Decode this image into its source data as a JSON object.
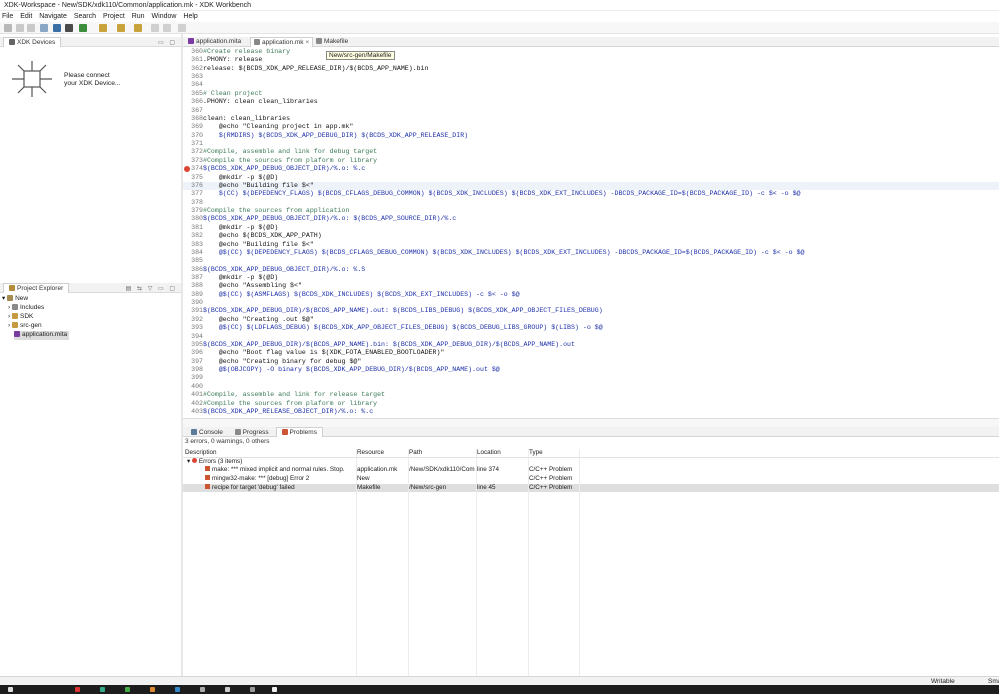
{
  "window": {
    "title": "XDK-Workspace - New/SDK/xdk110/Common/application.mk - XDK Workbench"
  },
  "menu": [
    "File",
    "Edit",
    "Navigate",
    "Search",
    "Project",
    "Run",
    "Window",
    "Help"
  ],
  "devices": {
    "tab": "XDK Devices",
    "message_line1": "Please connect",
    "message_line2": "your XDK Device..."
  },
  "explorer": {
    "tab": "Project Explorer",
    "items": [
      {
        "label": "New"
      },
      {
        "label": "Includes"
      },
      {
        "label": "SDK"
      },
      {
        "label": "src-gen"
      },
      {
        "label": "application.mita"
      }
    ]
  },
  "editor": {
    "tabs": [
      {
        "label": "application.mita"
      },
      {
        "label": "application.mk"
      },
      {
        "label": "Makefile"
      }
    ],
    "tooltip": "New/src-gen/Makefile",
    "lines": [
      {
        "n": "360",
        "t": "#Create release binary"
      },
      {
        "n": "361",
        "t": ".PHONY: release"
      },
      {
        "n": "362",
        "t": "release: $(BCDS_XDK_APP_RELEASE_DIR)/$(BCDS_APP_NAME).bin"
      },
      {
        "n": "363",
        "t": ""
      },
      {
        "n": "364",
        "t": ""
      },
      {
        "n": "365",
        "t": "# Clean project"
      },
      {
        "n": "366",
        "t": ".PHONY: clean clean_libraries"
      },
      {
        "n": "367",
        "t": ""
      },
      {
        "n": "368",
        "t": "clean: clean_libraries"
      },
      {
        "n": "369",
        "t": "    @echo \"Cleaning project in app.mk\""
      },
      {
        "n": "370",
        "t": "    $(RMDIRS) $(BCDS_XDK_APP_DEBUG_DIR) $(BCDS_XDK_APP_RELEASE_DIR)"
      },
      {
        "n": "371",
        "t": ""
      },
      {
        "n": "372",
        "t": "#Compile, assemble and link for debug target"
      },
      {
        "n": "373",
        "t": "#Compile the sources from plaform or library"
      },
      {
        "n": "374",
        "t": "$(BCDS_XDK_APP_DEBUG_OBJECT_DIR)/%.o: %.c"
      },
      {
        "n": "375",
        "t": "    @mkdir -p $(@D)"
      },
      {
        "n": "376",
        "t": "    @echo \"Building file $<\""
      },
      {
        "n": "377",
        "t": "    $(CC) $(DEPEDENCY_FLAGS) $(BCDS_CFLAGS_DEBUG_COMMON) $(BCDS_XDK_INCLUDES) $(BCDS_XDK_EXT_INCLUDES) -DBCDS_PACKAGE_ID=$(BCDS_PACKAGE_ID) -c $< -o $@"
      },
      {
        "n": "378",
        "t": ""
      },
      {
        "n": "379",
        "t": "#Compile the sources from application"
      },
      {
        "n": "380",
        "t": "$(BCDS_XDK_APP_DEBUG_OBJECT_DIR)/%.o: $(BCDS_APP_SOURCE_DIR)/%.c"
      },
      {
        "n": "381",
        "t": "    @mkdir -p $(@D)"
      },
      {
        "n": "382",
        "t": "    @echo $(BCDS_XDK_APP_PATH)"
      },
      {
        "n": "383",
        "t": "    @echo \"Building file $<\""
      },
      {
        "n": "384",
        "t": "    @$(CC) $(DEPEDENCY_FLAGS) $(BCDS_CFLAGS_DEBUG_COMMON) $(BCDS_XDK_INCLUDES) $(BCDS_XDK_EXT_INCLUDES) -DBCDS_PACKAGE_ID=$(BCDS_PACKAGE_ID) -c $< -o $@"
      },
      {
        "n": "385",
        "t": ""
      },
      {
        "n": "386",
        "t": "$(BCDS_XDK_APP_DEBUG_OBJECT_DIR)/%.o: %.S"
      },
      {
        "n": "387",
        "t": "    @mkdir -p $(@D)"
      },
      {
        "n": "388",
        "t": "    @echo \"Assembling $<\""
      },
      {
        "n": "389",
        "t": "    @$(CC) $(ASMFLAGS) $(BCDS_XDK_INCLUDES) $(BCDS_XDK_EXT_INCLUDES) -c $< -o $@"
      },
      {
        "n": "390",
        "t": ""
      },
      {
        "n": "391",
        "t": "$(BCDS_XDK_APP_DEBUG_DIR)/$(BCDS_APP_NAME).out: $(BCDS_LIBS_DEBUG) $(BCDS_XDK_APP_OBJECT_FILES_DEBUG)"
      },
      {
        "n": "392",
        "t": "    @echo \"Creating .out $@\""
      },
      {
        "n": "393",
        "t": "    @$(CC) $(LDFLAGS_DEBUG) $(BCDS_XDK_APP_OBJECT_FILES_DEBUG) $(BCDS_DEBUG_LIBS_GROUP) $(LIBS) -o $@"
      },
      {
        "n": "394",
        "t": ""
      },
      {
        "n": "395",
        "t": "$(BCDS_XDK_APP_DEBUG_DIR)/$(BCDS_APP_NAME).bin: $(BCDS_XDK_APP_DEBUG_DIR)/$(BCDS_APP_NAME).out"
      },
      {
        "n": "396",
        "t": "    @echo \"Boot flag value is $(XDK_FOTA_ENABLED_BOOTLOADER)\""
      },
      {
        "n": "397",
        "t": "    @echo \"Creating binary for debug $@\""
      },
      {
        "n": "398",
        "t": "    @$(OBJCOPY) -O binary $(BCDS_XDK_APP_DEBUG_DIR)/$(BCDS_APP_NAME).out $@"
      },
      {
        "n": "399",
        "t": ""
      },
      {
        "n": "400",
        "t": ""
      },
      {
        "n": "401",
        "t": "#Compile, assemble and link for release target"
      },
      {
        "n": "402",
        "t": "#Compile the sources from plaform or library"
      },
      {
        "n": "403",
        "t": "$(BCDS_XDK_APP_RELEASE_OBJECT_DIR)/%.o: %.c"
      }
    ]
  },
  "bottom": {
    "tabs": [
      {
        "label": "Console"
      },
      {
        "label": "Progress"
      },
      {
        "label": "Problems"
      }
    ],
    "summary": "3 errors, 0 warnings, 0 others",
    "columns": [
      "Description",
      "Resource",
      "Path",
      "Location",
      "Type"
    ],
    "group": "Errors (3 items)",
    "rows": [
      {
        "desc": "make: *** mixed implicit and normal rules.  Stop.",
        "res": "application.mk",
        "path": "/New/SDK/xdk110/Com...",
        "loc": "line 374",
        "type": "C/C++ Problem"
      },
      {
        "desc": "mingw32-make: *** [debug] Error 2",
        "res": "New",
        "path": "",
        "loc": "",
        "type": "C/C++ Problem"
      },
      {
        "desc": "recipe for target 'debug' failed",
        "res": "Makefile",
        "path": "/New/src-gen",
        "loc": "line 45",
        "type": "C/C++ Problem"
      }
    ]
  },
  "status": {
    "writable": "Writable",
    "insert": "Sma"
  },
  "colors": {
    "variable": "#1c2fa8",
    "comment": "#3b7a57",
    "error": "#d43",
    "selection": "#dedede"
  }
}
